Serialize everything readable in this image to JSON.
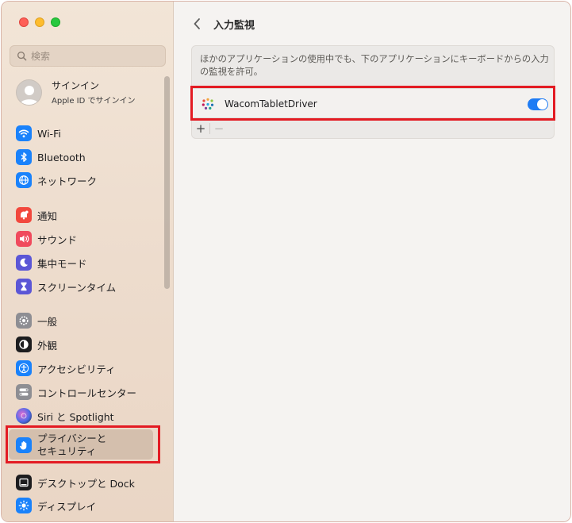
{
  "window": {
    "accent": "#1f7cf4",
    "highlight": "#e31b23"
  },
  "search": {
    "placeholder": "検索"
  },
  "account": {
    "name": "サインイン",
    "subtitle": "Apple ID でサインイン"
  },
  "sidebar": {
    "items": [
      {
        "label": "Wi-Fi",
        "icon": "wifi-icon",
        "color": "#1a82fb"
      },
      {
        "label": "Bluetooth",
        "icon": "bluetooth-icon",
        "color": "#1a82fb"
      },
      {
        "label": "ネットワーク",
        "icon": "globe-icon",
        "color": "#1a82fb"
      },
      {
        "label": "通知",
        "icon": "bell-icon",
        "color": "#f2483d"
      },
      {
        "label": "サウンド",
        "icon": "speaker-icon",
        "color": "#f04a5d"
      },
      {
        "label": "集中モード",
        "icon": "moon-icon",
        "color": "#5b56d6"
      },
      {
        "label": "スクリーンタイム",
        "icon": "hourglass-icon",
        "color": "#5b56d6"
      },
      {
        "label": "一般",
        "icon": "gear-icon",
        "color": "#8e8e93"
      },
      {
        "label": "外観",
        "icon": "appearance-icon",
        "color": "#1d1d1f"
      },
      {
        "label": "アクセシビリティ",
        "icon": "accessibility-icon",
        "color": "#1a82fb"
      },
      {
        "label": "コントロールセンター",
        "icon": "switches-icon",
        "color": "#8e8e93"
      },
      {
        "label": "Siri と Spotlight",
        "icon": "siri-icon",
        "color": "#3b2a6e"
      },
      {
        "label_line1": "プライバシーと",
        "label_line2": "セキュリティ",
        "icon": "hand-icon",
        "color": "#1a82fb",
        "selected": true
      },
      {
        "label": "デスクトップと Dock",
        "icon": "dock-icon",
        "color": "#1d1d1f"
      },
      {
        "label": "ディスプレイ",
        "icon": "brightness-icon",
        "color": "#1a82fb"
      }
    ]
  },
  "main": {
    "title": "入力監視",
    "description": "ほかのアプリケーションの使用中でも、下のアプリケーションにキーボードからの入力の監視を許可。",
    "apps": [
      {
        "name": "WacomTabletDriver",
        "enabled": true
      }
    ],
    "add_label": "+",
    "remove_label": "−"
  }
}
